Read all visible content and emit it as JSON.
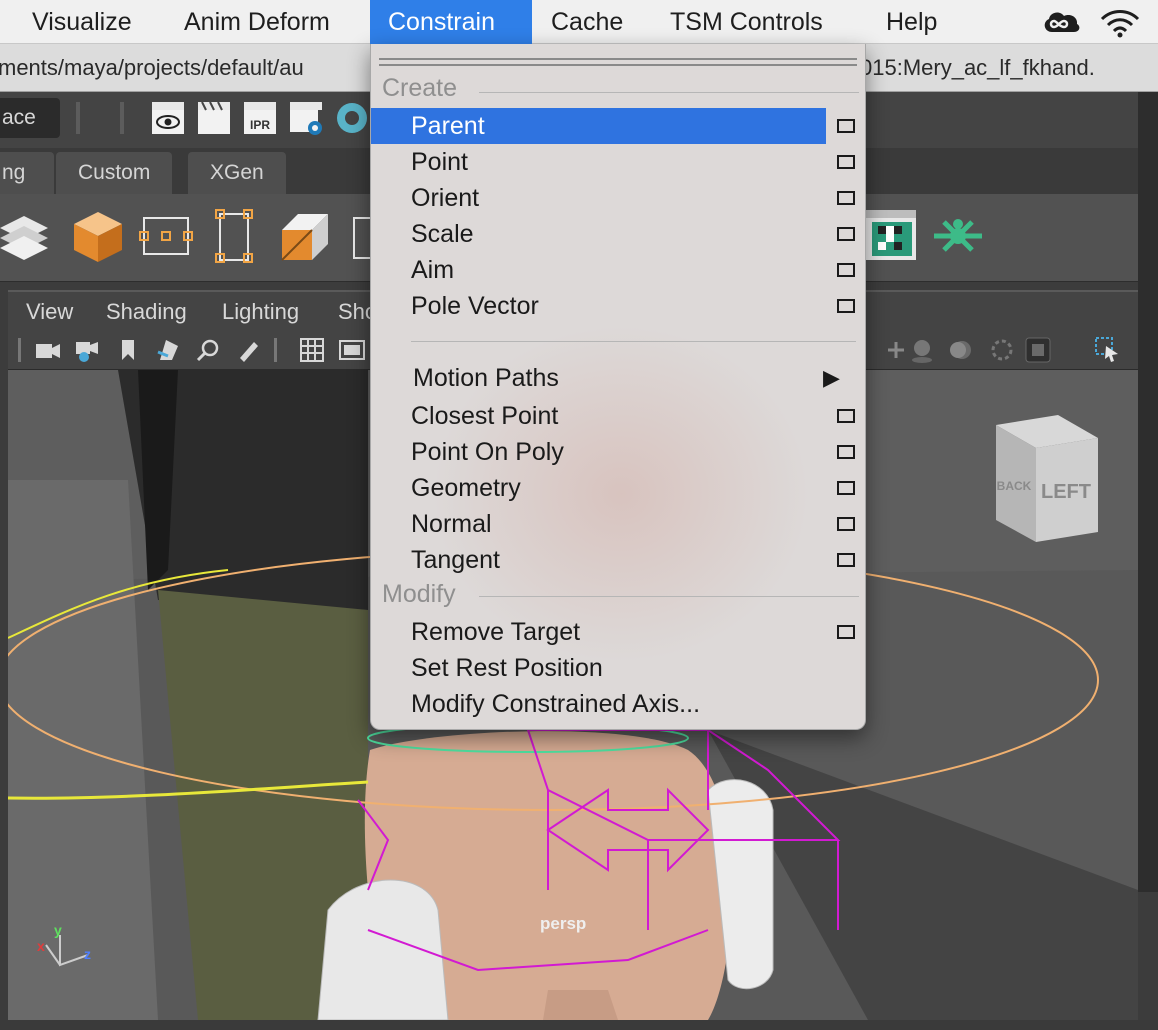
{
  "menubar": {
    "items": [
      "Visualize",
      "Anim Deform",
      "Constrain",
      "Cache",
      "TSM Controls",
      "Help"
    ],
    "active_item": "Constrain",
    "icons": [
      "creative-cloud-icon",
      "wifi-icon"
    ]
  },
  "pathbar": {
    "left_text": "ments/maya/projects/default/au",
    "right_text": "015:Mery_ac_lf_fkhand."
  },
  "statusline": {
    "workspace_label": "ace",
    "icons": [
      "render-view-eye-icon",
      "render-clapper-icon",
      "ipr-render-icon",
      "render-settings-icon",
      "hypershade-icon"
    ],
    "ipr_label": "IPR"
  },
  "shelf_tabs": [
    "ng",
    "Custom",
    "XGen"
  ],
  "shelf_icons": [
    "layers-stack-icon",
    "orange-cube-icon",
    "dotted-rectangle-icon",
    "vertical-rectangle-icon",
    "split-cube-icon",
    "checkerboard-icon",
    "green-connector-icon"
  ],
  "panel_menu": [
    "View",
    "Shading",
    "Lighting",
    "Sho"
  ],
  "viewport": {
    "camera_label": "persp",
    "view_cube_label": "LEFT",
    "view_cube_side_label": "BACK",
    "axis": {
      "x": "x",
      "y": "y",
      "z": "z"
    }
  },
  "colors": {
    "menu_bg": "#ddd9d8",
    "highlight": "#2f73e0",
    "active_menubar": "#2f7fe8",
    "maya_panel": "#444444",
    "viewport_bg": "#5c5c5c"
  },
  "dropdown": {
    "create_header": "Create",
    "modify_header": "Modify",
    "create_items": [
      {
        "label": "Parent",
        "has_option": true,
        "highlighted": true
      },
      {
        "label": "Point",
        "has_option": true
      },
      {
        "label": "Orient",
        "has_option": true
      },
      {
        "label": "Scale",
        "has_option": true
      },
      {
        "label": "Aim",
        "has_option": true
      },
      {
        "label": "Pole Vector",
        "has_option": true
      }
    ],
    "secondary_items": [
      {
        "label": "Motion Paths",
        "has_submenu": true
      },
      {
        "label": "Closest Point",
        "has_option": true
      },
      {
        "label": "Point On Poly",
        "has_option": true
      },
      {
        "label": "Geometry",
        "has_option": true
      },
      {
        "label": "Normal",
        "has_option": true
      },
      {
        "label": "Tangent",
        "has_option": true
      }
    ],
    "modify_items": [
      {
        "label": "Remove Target",
        "has_option": true
      },
      {
        "label": "Set Rest Position"
      },
      {
        "label": "Modify Constrained Axis..."
      }
    ]
  }
}
